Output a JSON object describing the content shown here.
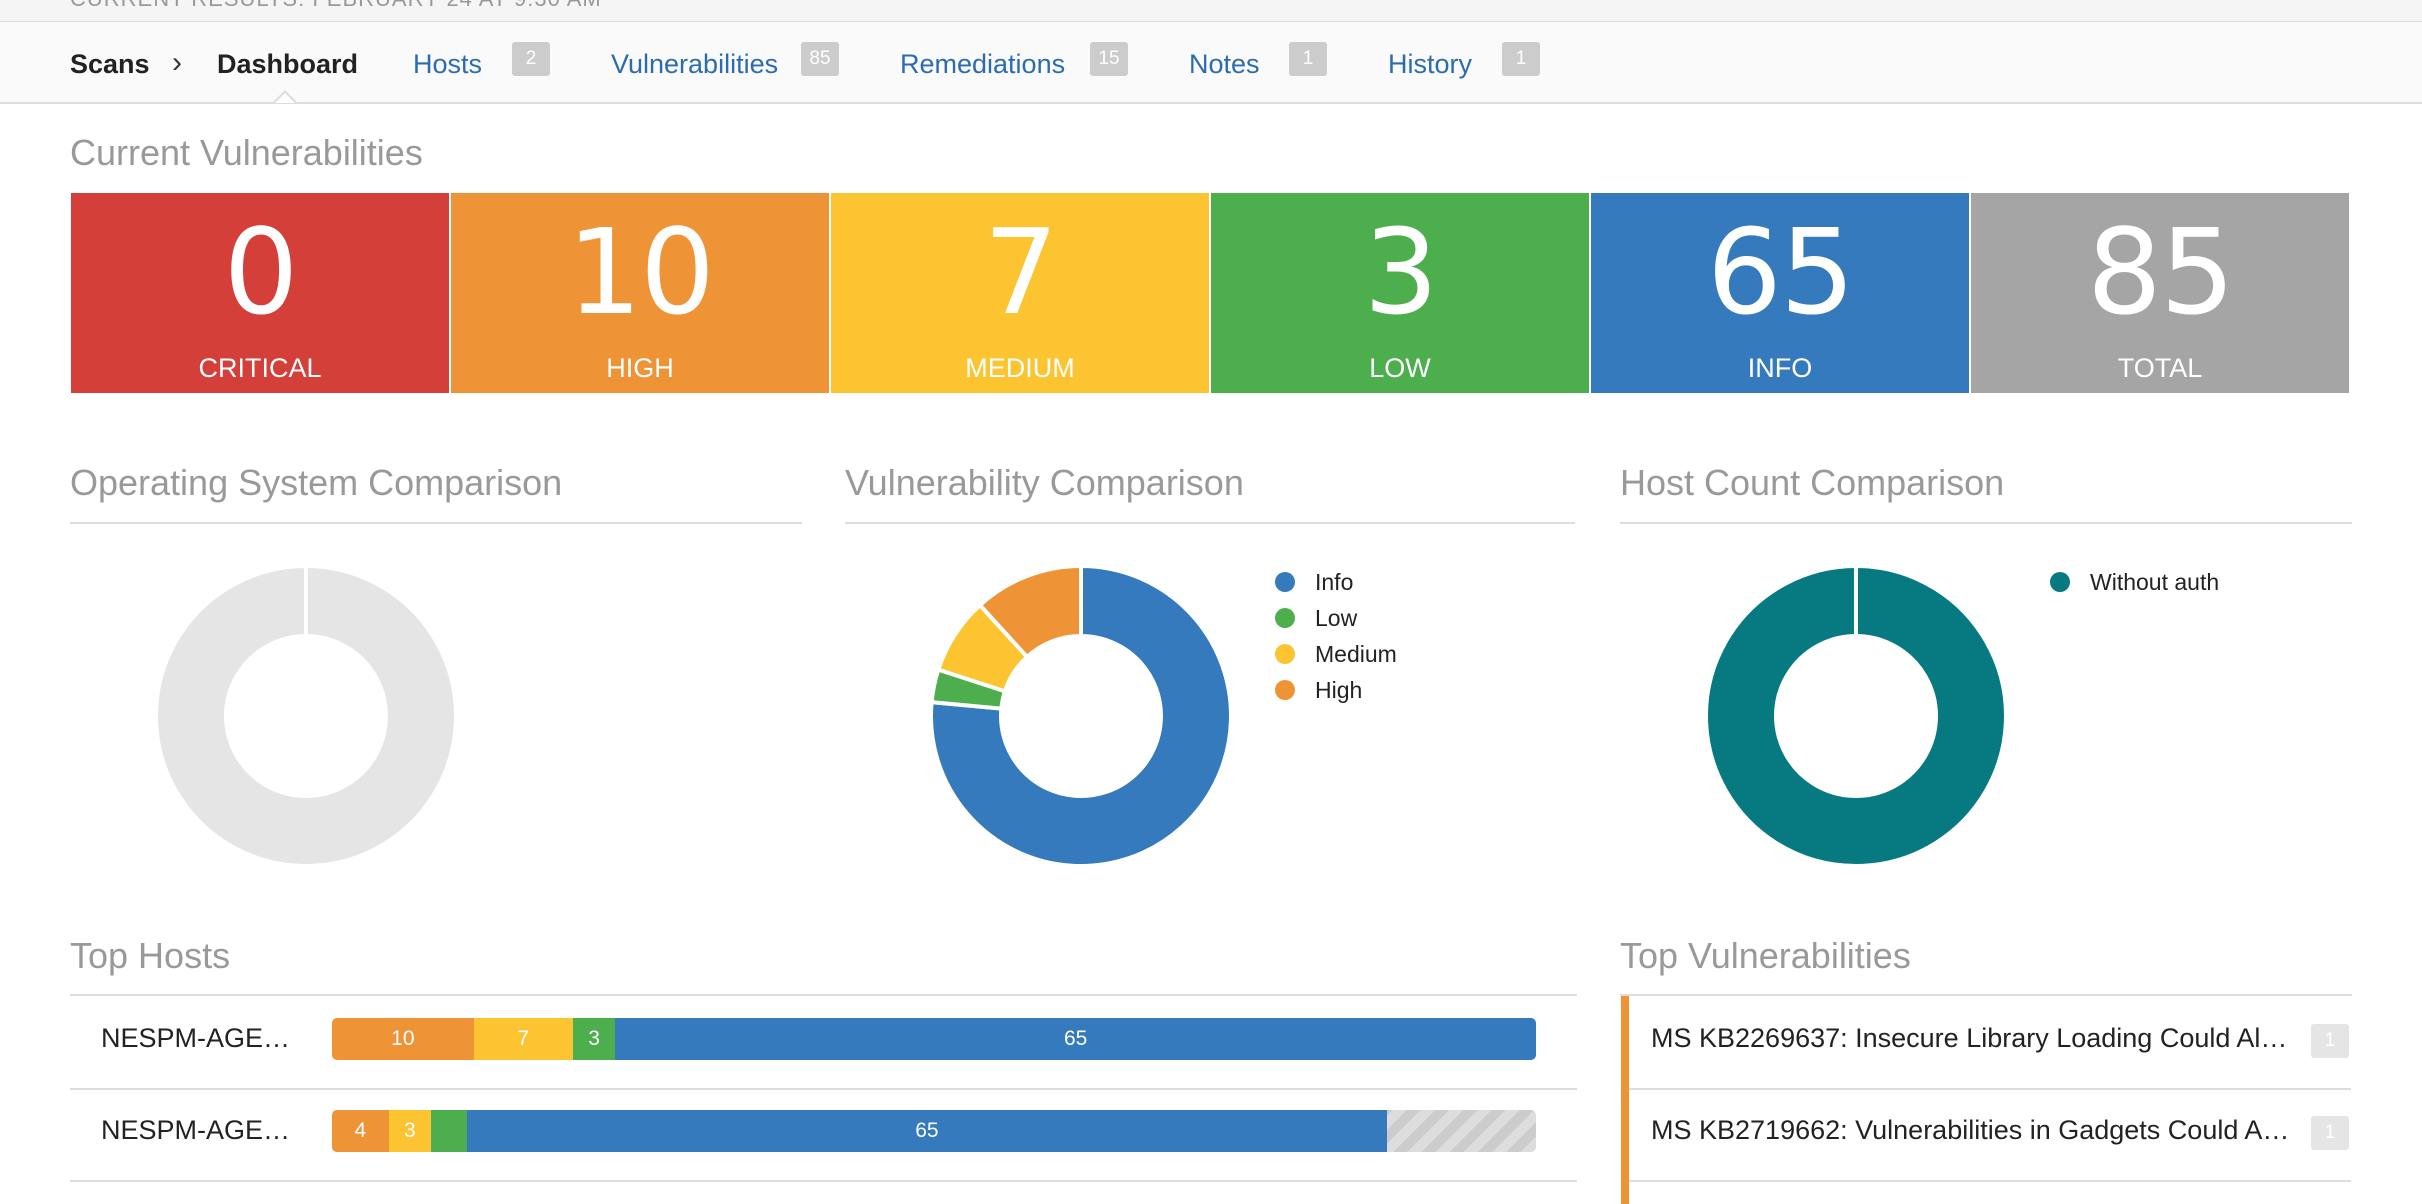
{
  "header": {
    "crumb_scans": "Scans",
    "crumb_dashboard": "Dashboard",
    "tabs": [
      {
        "label": "Hosts",
        "count": "2"
      },
      {
        "label": "Vulnerabilities",
        "count": "85"
      },
      {
        "label": "Remediations",
        "count": "15"
      },
      {
        "label": "Notes",
        "count": "1"
      },
      {
        "label": "History",
        "count": "1"
      }
    ]
  },
  "current": {
    "title": "Current Vulnerabilities",
    "boxes": [
      {
        "value": "0",
        "label": "CRITICAL",
        "color": "#d43f3a"
      },
      {
        "value": "10",
        "label": "HIGH",
        "color": "#ee9336"
      },
      {
        "value": "7",
        "label": "MEDIUM",
        "color": "#fdc431"
      },
      {
        "value": "3",
        "label": "LOW",
        "color": "#4cae4c"
      },
      {
        "value": "65",
        "label": "INFO",
        "color": "#357abd"
      },
      {
        "value": "85",
        "label": "TOTAL",
        "color": "#a5a5a5"
      }
    ]
  },
  "os_comparison": {
    "title": "Operating System Comparison"
  },
  "vuln_comparison": {
    "title": "Vulnerability Comparison",
    "legend": [
      {
        "label": "Info",
        "color": "#357abd"
      },
      {
        "label": "Low",
        "color": "#4cae4c"
      },
      {
        "label": "Medium",
        "color": "#fdc431"
      },
      {
        "label": "High",
        "color": "#ee9336"
      }
    ]
  },
  "host_comparison": {
    "title": "Host Count Comparison",
    "legend": [
      {
        "label": "Without auth",
        "color": "#067a80"
      }
    ]
  },
  "top_hosts": {
    "title": "Top Hosts",
    "rows": [
      {
        "name": "NESPM-AGE…",
        "segments": [
          {
            "label": "10",
            "value": 10,
            "color": "#ee9336"
          },
          {
            "label": "7",
            "value": 7,
            "color": "#fdc431"
          },
          {
            "label": "3",
            "value": 3,
            "color": "#4cae4c"
          },
          {
            "label": "65",
            "value": 65,
            "color": "#357abd"
          }
        ]
      },
      {
        "name": "NESPM-AGE…",
        "segments": [
          {
            "label": "4",
            "value": 4,
            "color": "#ee9336"
          },
          {
            "label": "3",
            "value": 3,
            "color": "#fdc431"
          },
          {
            "label": "",
            "value": 2.5,
            "color": "#4cae4c"
          },
          {
            "label": "65",
            "value": 65,
            "color": "#357abd"
          }
        ]
      }
    ]
  },
  "top_vulns": {
    "title": "Top Vulnerabilities",
    "rows": [
      {
        "text": "MS KB2269637: Insecure Library Loading Could Al…",
        "count": "1"
      },
      {
        "text": "MS KB2719662: Vulnerabilities in Gadgets Could A…",
        "count": "1"
      }
    ]
  },
  "chart_data": [
    {
      "type": "pie",
      "title": "Operating System Comparison",
      "labels": [],
      "values": []
    },
    {
      "type": "pie",
      "title": "Vulnerability Comparison",
      "labels": [
        "Info",
        "Low",
        "Medium",
        "High"
      ],
      "values": [
        65,
        3,
        7,
        10
      ]
    },
    {
      "type": "pie",
      "title": "Host Count Comparison",
      "labels": [
        "Without auth"
      ],
      "values": [
        2
      ]
    }
  ]
}
